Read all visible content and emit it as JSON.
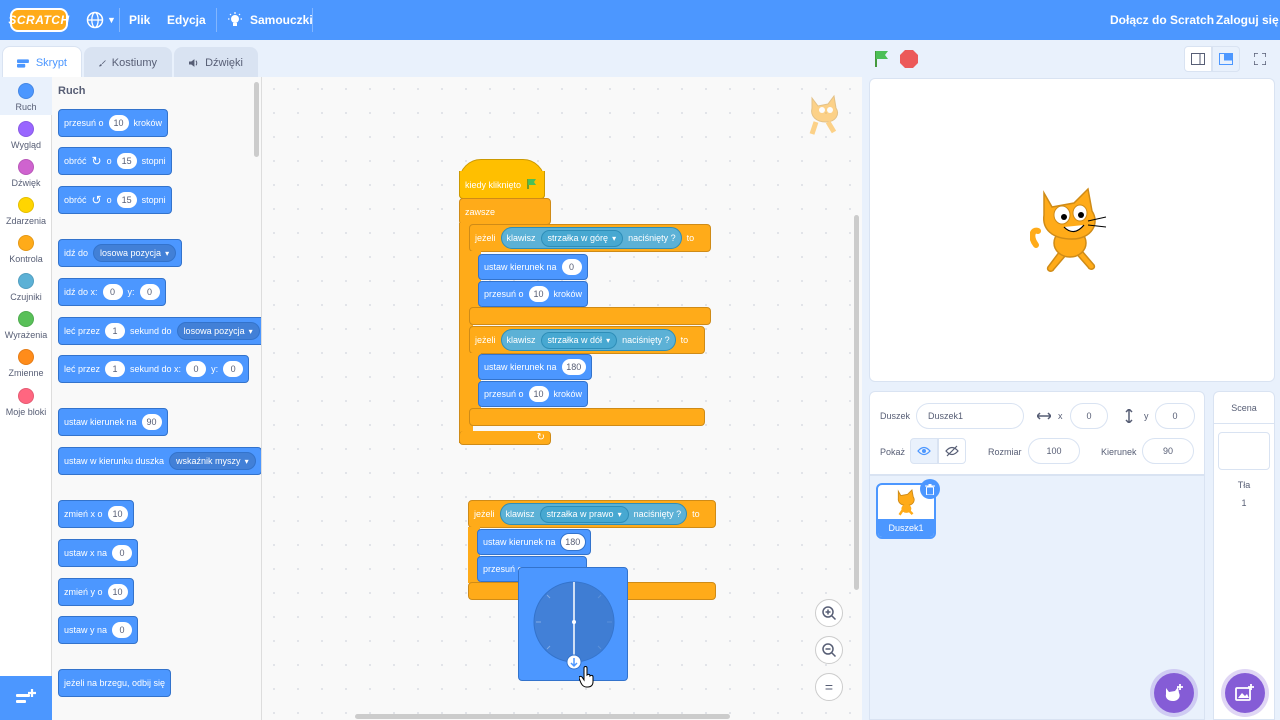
{
  "menubar": {
    "logo": "SCRATCH",
    "file": "Plik",
    "edit": "Edycja",
    "tutorials": "Samouczki",
    "join": "Dołącz do Scratch",
    "signin": "Zaloguj się"
  },
  "tabs": {
    "code": "Skrypt",
    "costumes": "Kostiumy",
    "sounds": "Dźwięki"
  },
  "categories": [
    {
      "label": "Ruch",
      "color": "#4c97ff"
    },
    {
      "label": "Wygląd",
      "color": "#9966ff"
    },
    {
      "label": "Dźwięk",
      "color": "#cf63cf"
    },
    {
      "label": "Zdarzenia",
      "color": "#ffd500"
    },
    {
      "label": "Kontrola",
      "color": "#ffab19"
    },
    {
      "label": "Czujniki",
      "color": "#5cb1d6"
    },
    {
      "label": "Wyrażenia",
      "color": "#59c059"
    },
    {
      "label": "Zmienne",
      "color": "#ff8c1a"
    },
    {
      "label": "Moje bloki",
      "color": "#ff6680"
    }
  ],
  "palette": {
    "title": "Ruch",
    "move": {
      "a": "przesuń o",
      "v": "10",
      "b": "kroków"
    },
    "turn_right": {
      "a": "obróć",
      "b": "o",
      "v": "15",
      "c": "stopni"
    },
    "turn_left": {
      "a": "obróć",
      "b": "o",
      "v": "15",
      "c": "stopni"
    },
    "goto": {
      "a": "idź do",
      "dd": "losowa pozycja"
    },
    "goto_xy": {
      "a": "idź do x:",
      "x": "0",
      "b": "y:",
      "y": "0"
    },
    "glide": {
      "a": "leć przez",
      "v": "1",
      "b": "sekund do",
      "dd": "losowa pozycja"
    },
    "glide_xy": {
      "a": "leć przez",
      "v": "1",
      "b": "sekund do x:",
      "x": "0",
      "c": "y:",
      "y": "0"
    },
    "point_dir": {
      "a": "ustaw kierunek na",
      "v": "90"
    },
    "point_towards": {
      "a": "ustaw w kierunku duszka",
      "dd": "wskaźnik myszy"
    },
    "change_x": {
      "a": "zmień x o",
      "v": "10"
    },
    "set_x": {
      "a": "ustaw x na",
      "v": "0"
    },
    "change_y": {
      "a": "zmień y o",
      "v": "10"
    },
    "set_y": {
      "a": "ustaw y na",
      "v": "0"
    },
    "bounce": {
      "a": "jeżeli na brzegu, odbij się"
    }
  },
  "script": {
    "hat": "kiedy kliknięto",
    "forever": "zawsze",
    "if_label": "jeżeli",
    "then": "to",
    "key": "klawisz",
    "pressed": "naciśnięty ?",
    "key_up": "strzałka w górę",
    "key_down": "strzałka w dół",
    "key_right": "strzałka w prawo",
    "set_dir": "ustaw kierunek na",
    "move": "przesuń o",
    "steps": "kroków",
    "dir_up": "0",
    "dir_down": "180",
    "dir_right": "180",
    "move_val": "10",
    "move_partial": "przesuń o"
  },
  "sprite_info": {
    "sprite_label": "Duszek",
    "sprite_name": "Duszek1",
    "x_label": "x",
    "x": "0",
    "y_label": "y",
    "y": "0",
    "show_label": "Pokaż",
    "size_label": "Rozmiar",
    "size": "100",
    "direction_label": "Kierunek",
    "direction": "90"
  },
  "sprites": [
    {
      "name": "Duszek1"
    }
  ],
  "scene": {
    "title": "Scena",
    "backdrops_label": "Tła",
    "backdrops_count": "1"
  },
  "colors": {
    "accent": "#4c97ff",
    "control": "#ffab19",
    "events": "#ffbf00",
    "sensing": "#5cb1d6"
  }
}
